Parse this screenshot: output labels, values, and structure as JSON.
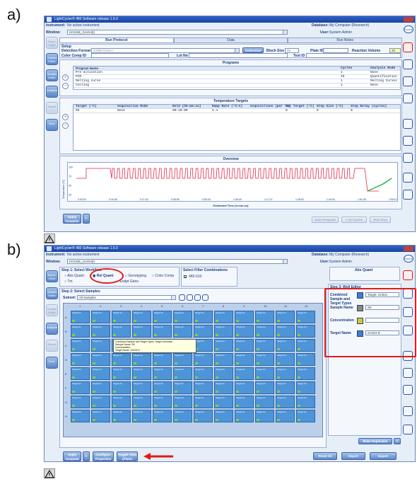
{
  "labels": {
    "a": "a)",
    "b": "b)"
  },
  "a": {
    "window_title": "LightCycler® 480 Software release 1.5.0",
    "instrument_label": "Instrument:",
    "instrument_value": "No active instrument",
    "window_label": "Window:",
    "window_value": "HOUSE_GAGH(I)",
    "database_label": "Database:",
    "database_value": "My Computer (Research)",
    "user_label": "User:",
    "user_value": "System Admin",
    "tabs": [
      "Run Protocol",
      "Data",
      "Run Notes"
    ],
    "setup_label": "Setup",
    "detection_format_label": "Detection Format",
    "detection_format_value": "SYBR Green I",
    "customize_label": "Customize",
    "block_size_label": "Block Size",
    "block_size_value": "96",
    "plate_id_label": "Plate ID",
    "reaction_volume_label": "Reaction Volume",
    "reaction_volume_value": "20",
    "color_comp_label": "Color Comp ID",
    "lot_no_label": "Lot No",
    "test_id_label": "Test ID",
    "programs_title": "Programs",
    "programs_headers": [
      "Program Name",
      "Cycles",
      "Analysis Mode"
    ],
    "programs_rows": [
      {
        "name": "Pre-activation",
        "cycles": "1",
        "mode": "None"
      },
      {
        "name": "PCR",
        "cycles": "45",
        "mode": "Quantification"
      },
      {
        "name": "Melting curve",
        "cycles": "1",
        "mode": "Melting Curves"
      },
      {
        "name": "Cooling",
        "cycles": "1",
        "mode": "None"
      }
    ],
    "targets_title": "Temperature Targets",
    "targets_headers": [
      "Target (°C)",
      "Acquisition Mode",
      "Hold (hh:mm:ss)",
      "Ramp Rate (°C/s)",
      "Acquisitions (per °C)",
      "Sec Target (°C)",
      "Step Size (°C)",
      "Step Delay (cycles)"
    ],
    "targets_row": [
      "95",
      "None",
      "00:10:00",
      "4.4",
      "",
      "0",
      "0",
      "0"
    ],
    "overview_title": "Overview",
    "x_axis_label": "Estimated Time (h:mm:ss)",
    "y_axis_label": "Temperature (°C)",
    "x_ticks": [
      "0:00:00",
      "0:16:36",
      "0:27:42",
      "0:38:56",
      "0:55:34",
      "1:06:40",
      "1:17:47",
      "1:28:53",
      "1:40:00",
      "1:51:06",
      "1:59:12"
    ],
    "y_ticks": [
      "100",
      "75",
      "50",
      "25"
    ],
    "apply_template": "Apply Template",
    "bottom_buttons": [
      "Start Program",
      "+ 10 Cycles",
      "Start Run"
    ],
    "nav": [
      "Exper-iment",
      "Subset Editor",
      "Sample Editor",
      "Analysis",
      "Report",
      "Sum."
    ],
    "accent_red": "#d01818"
  },
  "b": {
    "window_title": "LightCycler® 480 Software release 1.5.0",
    "instrument_label": "Instrument:",
    "instrument_value": "No active instrument",
    "window_label": "Window:",
    "window_value": "HOUSE_GAGH(I)",
    "database_label": "Database:",
    "database_value": "My Computer (Research)",
    "user_label": "User:",
    "user_value": "System Admin",
    "step1_label": "Step 1: Select Workflow",
    "workflows": [
      "Abs Quant",
      "Rel Quant",
      "Genotyping",
      "Color Comp",
      "Tm",
      "Endpt Geno"
    ],
    "step_filter_label": "Select Filter Combinations",
    "filter_value": "465-510",
    "abs_quant_label": "Abs Quant",
    "step2_label": "Step 2: Select Samples",
    "subset_label": "Subset:",
    "subset_value": "All Samples",
    "step3_label": "Step 3: Well Editor",
    "well_editor_fields": [
      {
        "label": "Combined Sample and Target Types",
        "value": "Target: Unkno"
      },
      {
        "label": "Sample Name",
        "value": "S5"
      },
      {
        "label": "Concentration",
        "value": ""
      },
      {
        "label": "Target Name",
        "value": "GAGH-D"
      }
    ],
    "columns": [
      "1",
      "2",
      "3",
      "4",
      "5",
      "5",
      "7",
      "8",
      "9",
      "10",
      "11",
      "12"
    ],
    "rows": [
      "A",
      "B",
      "C",
      "D",
      "E",
      "F",
      "G",
      "H"
    ],
    "well_text": "Target Un",
    "tooltip_lines": [
      "Combined Sample and Target Types: Target Unknown",
      "Sample Name: S5",
      "Concentration:",
      "Target Name: GAGH-D"
    ],
    "bottom_buttons": [
      "Apply Template",
      "Configure Properties",
      "Toggle View (Plate)"
    ],
    "right_buttons": [
      "Make Replicates",
      "Reset All",
      "Import",
      "Export"
    ],
    "nav": [
      "Exper-iment",
      "Subset Editor",
      "Sample Editor",
      "Analysis",
      "Report",
      "Sum."
    ],
    "accent_red": "#e21a1a"
  }
}
